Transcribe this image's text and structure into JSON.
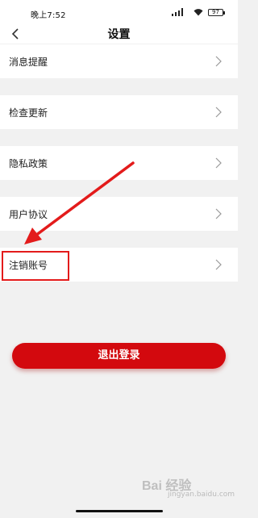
{
  "status_bar": {
    "time": "晚上7:52",
    "battery": "97",
    "icons": [
      "signal-icon",
      "wifi-icon",
      "battery-icon"
    ]
  },
  "header": {
    "title": "设置",
    "back_icon": "chevron-left-icon"
  },
  "menu": {
    "items": [
      {
        "label": "消息提醒"
      },
      {
        "label": "检查更新"
      },
      {
        "label": "隐私政策"
      },
      {
        "label": "用户协议"
      },
      {
        "label": "注销账号"
      }
    ]
  },
  "logout": {
    "label": "退出登录"
  },
  "watermark": {
    "text": "Bai 经验",
    "sub": "jingyan.baidu.com"
  },
  "colors": {
    "accent": "#d3090e",
    "highlight": "#e31b1b",
    "background": "#f1f1f1"
  }
}
